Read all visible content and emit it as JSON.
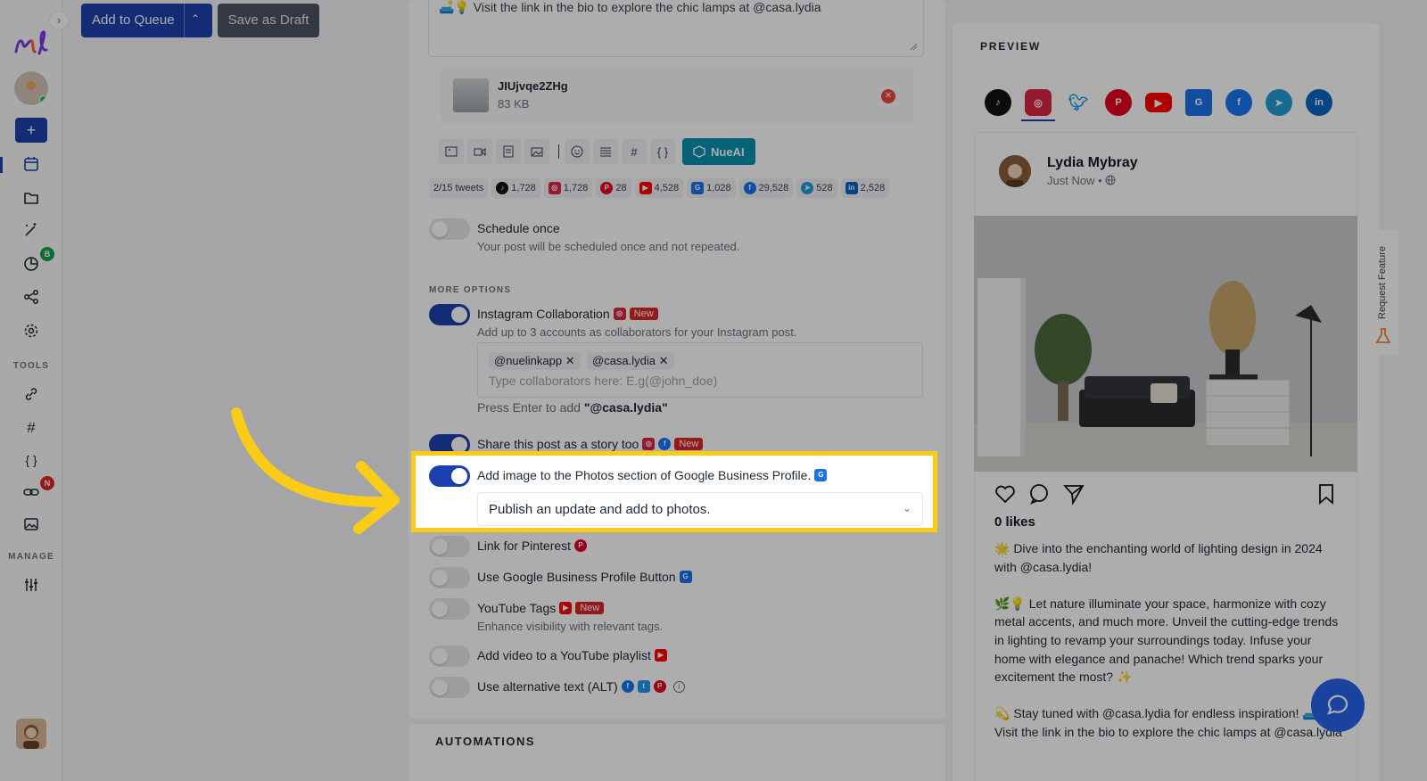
{
  "sidebar": {
    "logo": "nl",
    "collapse_glyph": "›",
    "add_glyph": "+",
    "sections": {
      "tools": "TOOLS",
      "manage": "MANAGE"
    },
    "badges": {
      "analytics": "B",
      "links": "N"
    },
    "icons": [
      "calendar-icon",
      "folder-icon",
      "magic-wand-icon",
      "analytics-icon",
      "share-icon",
      "gear-icon",
      "link-icon",
      "hashtag-icon",
      "braces-icon",
      "short-link-icon",
      "media-library-icon",
      "sliders-icon"
    ]
  },
  "topbar": {
    "add_to_queue": "Add to Queue",
    "save_as_draft": "Save as Draft"
  },
  "editor": {
    "text": "🛋️💡 Visit the link in the bio to explore the chic lamps at @casa.lydia",
    "attachment": {
      "name": "JIUjvqe2ZHg",
      "size": "83 KB"
    },
    "toolbar": {
      "braces": "{ }",
      "hash": "#",
      "nueai": "NueAI"
    },
    "counts": {
      "tweets": "2/15 tweets",
      "tiktok": "1,728",
      "instagram": "1,728",
      "pinterest": "28",
      "youtube": "4,528",
      "gbp": "1,028",
      "facebook": "29,528",
      "telegram": "528",
      "linkedin": "2,528"
    }
  },
  "options": {
    "schedule_once": {
      "label": "Schedule once",
      "desc": "Your post will be scheduled once and not repeated."
    },
    "more_options_title": "MORE OPTIONS",
    "instagram_collab": {
      "label": "Instagram Collaboration",
      "badge": "New",
      "desc": "Add up to 3 accounts as collaborators for your Instagram post.",
      "chips": [
        "@nuelinkapp",
        "@casa.lydia"
      ],
      "placeholder": "Type collaborators here: E.g(@john_doe)",
      "hint_prefix": "Press Enter to add",
      "hint_value": "\"@casa.lydia\""
    },
    "story": {
      "label": "Share this post as a story too",
      "badge": "New"
    },
    "gbp_photos": {
      "label": "Add image to the Photos section of Google Business Profile.",
      "select_value": "Publish an update and add to photos."
    },
    "pinterest_link": {
      "label": "Link for Pinterest"
    },
    "gbp_button": {
      "label": "Use Google Business Profile Button"
    },
    "youtube_tags": {
      "label": "YouTube Tags",
      "badge": "New",
      "desc": "Enhance visibility with relevant tags."
    },
    "youtube_playlist": {
      "label": "Add video to a YouTube playlist"
    },
    "alt_text": {
      "label": "Use alternative text (ALT)"
    },
    "automations_title": "AUTOMATIONS"
  },
  "preview": {
    "title": "PREVIEW",
    "networks": [
      "tiktok",
      "instagram",
      "twitter",
      "pinterest",
      "youtube",
      "google-business",
      "facebook",
      "telegram",
      "linkedin"
    ],
    "selected_network": "instagram",
    "author": "Lydia Mybray",
    "time": "Just Now •",
    "likes": "0 likes",
    "caption": [
      "🌟 Dive into the enchanting world of lighting design in 2024 with @casa.lydia!",
      "🌿💡 Let nature illuminate your space, harmonize with cozy metal accents, and much more. Unveil the cutting-edge trends in lighting to revamp your surroundings today. Infuse your home with elegance and panache! Which trend sparks your excitement the most? ✨",
      "💫 Stay tuned with @casa.lydia for endless inspiration! 🛋️💡 Visit the link in the bio to explore the chic lamps at @casa.lydia"
    ]
  },
  "request_feature": "Request Feature",
  "colors": {
    "primary": "#1e40af",
    "highlight": "#facc15",
    "danger": "#dc2626",
    "nueai": "#0891b2"
  }
}
